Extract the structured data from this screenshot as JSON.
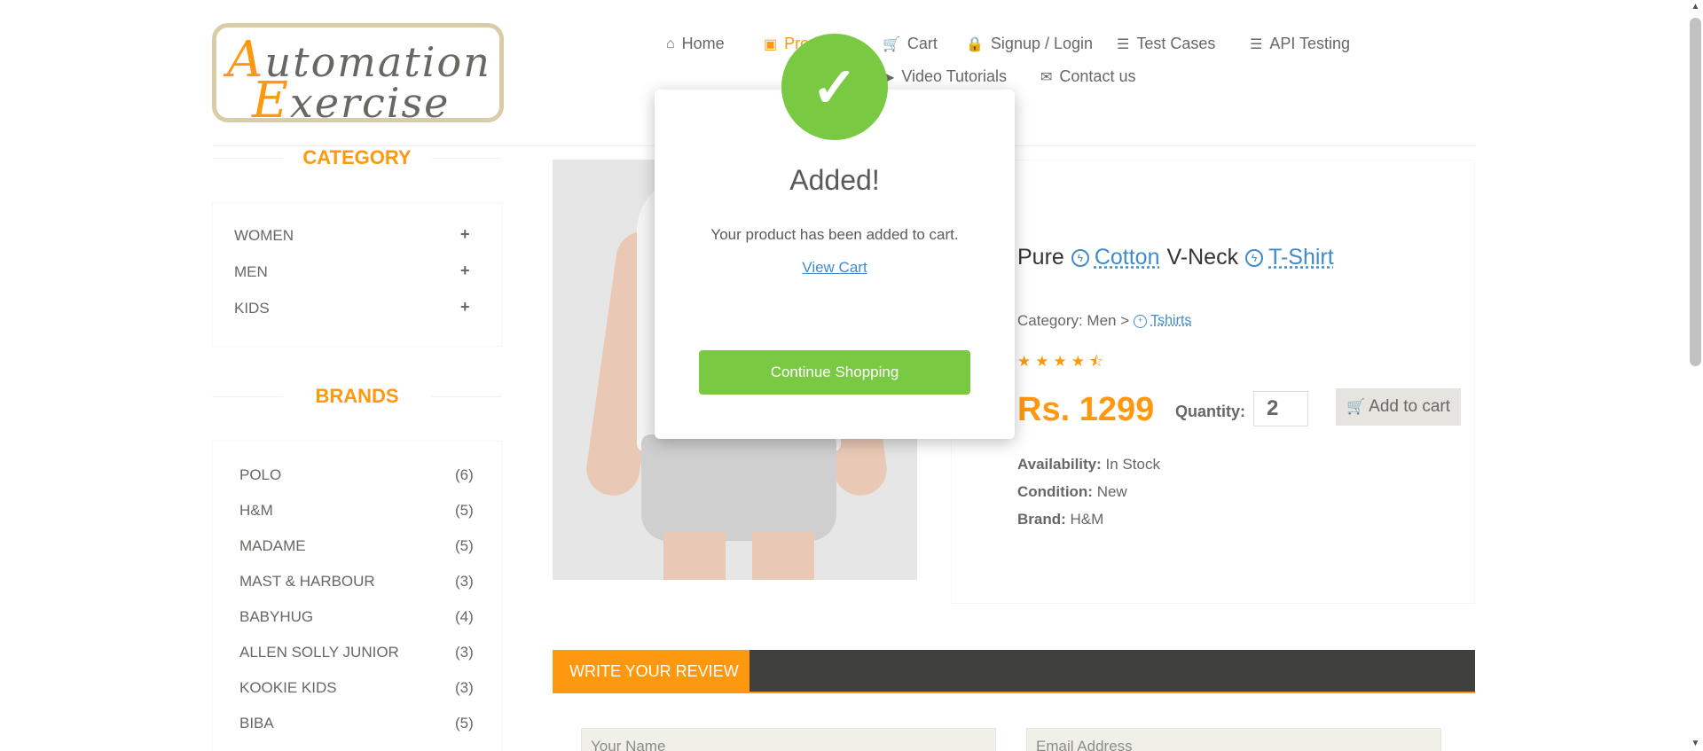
{
  "logo": {
    "line1_cap": "A",
    "line1_rest": "utomation",
    "line2_cap": "E",
    "line2_rest": "xercise"
  },
  "nav": {
    "home": "Home",
    "products": "Products",
    "cart": "Cart",
    "signup": "Signup / Login",
    "test_cases": "Test Cases",
    "api_testing": "API Testing",
    "video_tutorials": "Video Tutorials",
    "contact": "Contact us"
  },
  "sidebar": {
    "category_title": "CATEGORY",
    "categories": [
      {
        "label": "WOMEN",
        "icon": "+"
      },
      {
        "label": "MEN",
        "icon": "+"
      },
      {
        "label": "KIDS",
        "icon": "+"
      }
    ],
    "brands_title": "BRANDS",
    "brands": [
      {
        "name": "POLO",
        "count": "(6)"
      },
      {
        "name": "H&M",
        "count": "(5)"
      },
      {
        "name": "MADAME",
        "count": "(5)"
      },
      {
        "name": "MAST & HARBOUR",
        "count": "(3)"
      },
      {
        "name": "BABYHUG",
        "count": "(4)"
      },
      {
        "name": "ALLEN SOLLY JUNIOR",
        "count": "(3)"
      },
      {
        "name": "KOOKIE KIDS",
        "count": "(3)"
      },
      {
        "name": "BIBA",
        "count": "(5)"
      }
    ]
  },
  "product": {
    "title_part1": "Pure",
    "title_link1": "Cotton",
    "title_part2": "V-Neck",
    "title_link2": "T-Shirt",
    "category_prefix": "Category: Men >",
    "category_link": "Tshirts",
    "rating": 4.5,
    "price": "Rs. 1299",
    "quantity_label": "Quantity:",
    "quantity_value": "2",
    "add_to_cart": "Add to cart",
    "availability_label": "Availability:",
    "availability_value": "In Stock",
    "condition_label": "Condition:",
    "condition_value": "New",
    "brand_label": "Brand:",
    "brand_value": "H&M"
  },
  "review": {
    "tab_label": "WRITE YOUR REVIEW",
    "name_placeholder": "Your Name",
    "email_placeholder": "Email Address"
  },
  "modal": {
    "title": "Added!",
    "message": "Your product has been added to cart.",
    "view_cart": "View Cart",
    "continue_button": "Continue Shopping"
  },
  "colors": {
    "accent": "#fe980f",
    "success": "#7ac943",
    "link": "#428bca",
    "review_bar": "#40403e"
  }
}
